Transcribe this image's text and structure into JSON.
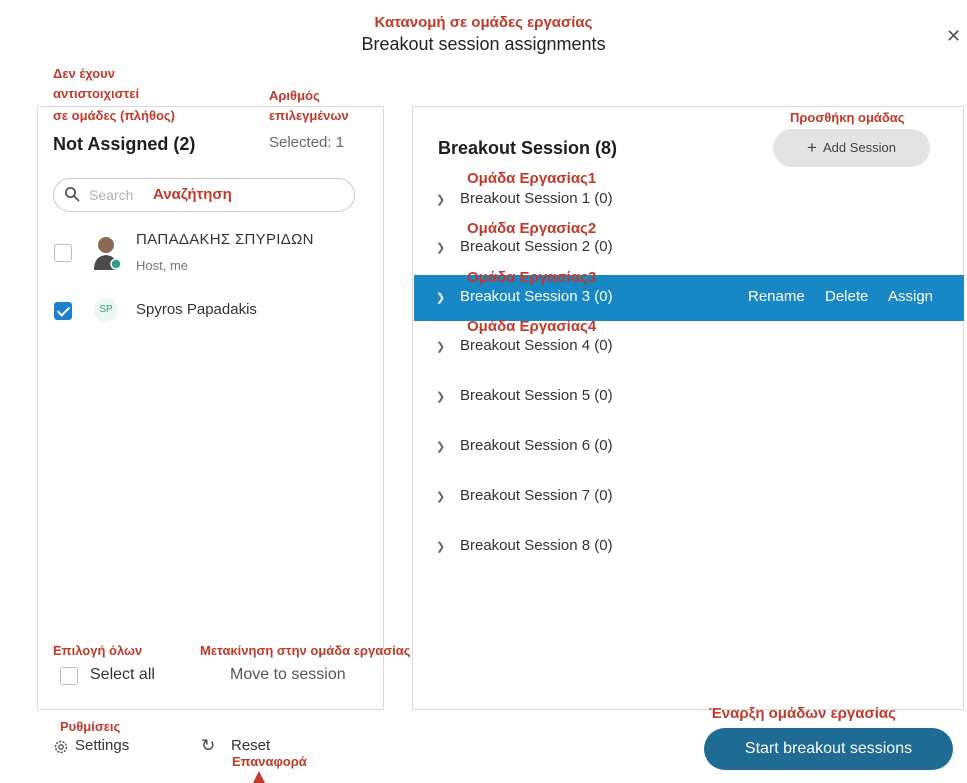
{
  "dialog": {
    "title_gr": "Κατανομή σε ομάδες εργασίας",
    "title_en": "Breakout session assignments",
    "close_icon": "close-icon"
  },
  "annotations": {
    "not_assigned_gr": [
      "Δεν έχουν",
      "αντιστοιχιστεί",
      "σε ομάδες (πλήθος)"
    ],
    "selected_gr": [
      "Αριθμός",
      "επιλεγμένων"
    ],
    "search_gr": "Αναζήτηση",
    "add_session_gr": "Προσθήκη ομάδας",
    "session_names_gr": [
      "Ομάδα Εργασίας1",
      "Ομάδα Εργασίας2",
      "Ομάδα Εργασίας3",
      "Ομάδα Εργασίας4"
    ],
    "select_all_gr": "Επιλογή όλων",
    "move_gr": "Μετακίνηση στην ομάδα εργασίας",
    "settings_gr": "Ρυθμίσεις",
    "reset_gr": "Επαναφορά",
    "start_gr": "Έναρξη ομάδων εργασίας"
  },
  "left_panel": {
    "header": "Not Assigned (2)",
    "selected": "Selected: 1",
    "search_placeholder": "Search",
    "participants": [
      {
        "name": "ΠΑΠΑΔΑΚΗΣ ΣΠΥΡΙΔΩΝ",
        "role": "Host, me",
        "checked": false
      },
      {
        "name": "Spyros Papadakis",
        "initials": "SP",
        "checked": true
      }
    ],
    "select_all": "Select all",
    "move_to_session": "Move to session"
  },
  "right_panel": {
    "header": "Breakout Session  (8)",
    "add_session": "Add Session",
    "sessions": [
      "Breakout Session 1 (0)",
      "Breakout Session 2 (0)",
      "Breakout Session 3 (0)",
      "Breakout Session 4 (0)",
      "Breakout Session 5 (0)",
      "Breakout Session 6 (0)",
      "Breakout Session 7 (0)",
      "Breakout Session 8 (0)"
    ],
    "selected_session_index": 2,
    "row_actions": [
      "Rename",
      "Delete",
      "Assign"
    ]
  },
  "footer": {
    "settings": "Settings",
    "reset": "Reset",
    "start": "Start breakout sessions"
  },
  "colors": {
    "highlight": "#1787c5",
    "start_button": "#1e6b93",
    "annotation": "#c0392b",
    "checkbox_checked": "#1d7fd0"
  }
}
